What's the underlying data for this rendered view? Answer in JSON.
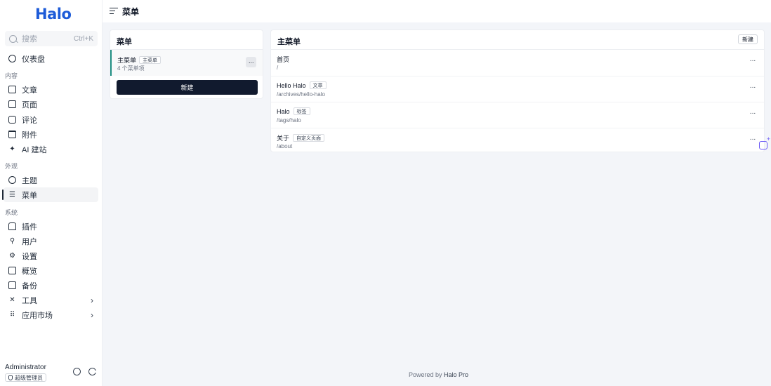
{
  "brand": {
    "logo": "Halo",
    "color": "#1d5bd8"
  },
  "search": {
    "placeholder": "搜索",
    "shortcut": "Ctrl+K",
    "icon": "search-icon"
  },
  "sidebar": {
    "dashboard": "仪表盘",
    "groups": {
      "content": "内容",
      "appearance": "外观",
      "system": "系统"
    },
    "items": {
      "posts": "文章",
      "pages": "页面",
      "comments": "评论",
      "attachments": "附件",
      "ai": "AI 建站",
      "themes": "主题",
      "menus": "菜单",
      "plugins": "插件",
      "users": "用户",
      "settings": "设置",
      "overview": "概览",
      "backup": "备份",
      "tools": "工具",
      "market": "应用市场"
    },
    "active": "menus"
  },
  "user": {
    "name": "Administrator",
    "role": "超级管理员"
  },
  "header": {
    "title": "菜单"
  },
  "menus_card": {
    "title": "菜单",
    "menu": {
      "name": "主菜单",
      "tag": "主菜单",
      "count": "4 个菜单项",
      "more": "···"
    },
    "new_button": "新建",
    "accent": "#1f8e82"
  },
  "items_card": {
    "title": "主菜单",
    "new_button": "新建",
    "items": [
      {
        "label": "首页",
        "tag": "",
        "path": "/",
        "more": "···"
      },
      {
        "label": "Hello Halo",
        "tag": "文章",
        "path": "/archives/hello-halo",
        "more": "···"
      },
      {
        "label": "Halo",
        "tag": "标签",
        "path": "/tags/halo",
        "more": "···"
      },
      {
        "label": "关于",
        "tag": "自定义页面",
        "path": "/about",
        "more": "···"
      }
    ]
  },
  "footer": {
    "prefix": "Powered by",
    "brand": "Halo Pro"
  }
}
